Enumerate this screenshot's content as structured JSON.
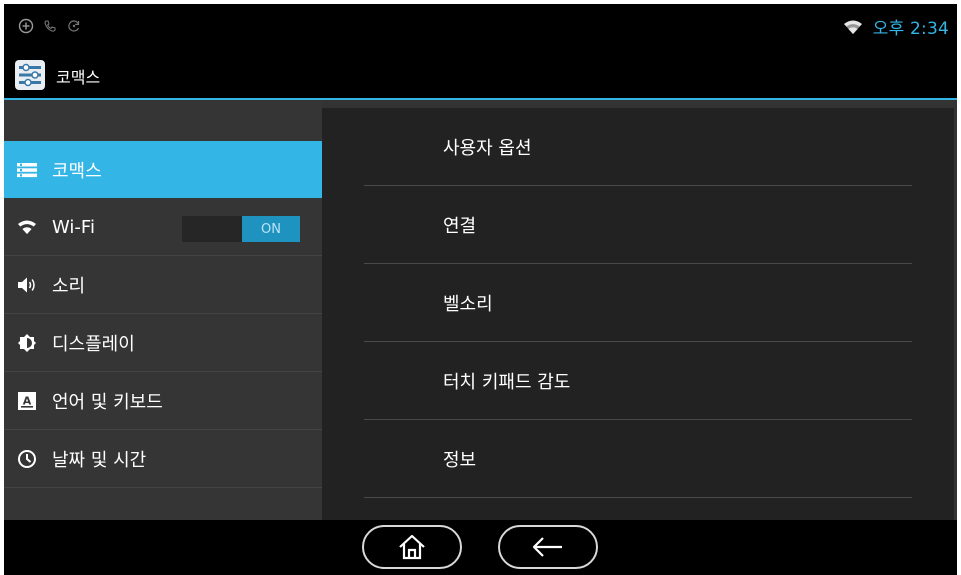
{
  "status_bar": {
    "left_icons": [
      "add-circle-icon",
      "phone-icon",
      "sync-icon"
    ],
    "wifi_icon": "wifi-icon",
    "time": "오후 2:34",
    "accent_color": "#33b5e5"
  },
  "action_bar": {
    "app_icon": "settings-sliders-icon",
    "title": "코맥스"
  },
  "sidebar": {
    "items": [
      {
        "label": "코맥스",
        "icon": "list-icon",
        "selected": true
      },
      {
        "label": "Wi-Fi",
        "icon": "wifi-icon",
        "toggle": "ON"
      },
      {
        "label": "소리",
        "icon": "speaker-icon"
      },
      {
        "label": "디스플레이",
        "icon": "brightness-icon"
      },
      {
        "label": "언어 및 키보드",
        "icon": "keyboard-a-icon"
      },
      {
        "label": "날짜 및 시간",
        "icon": "clock-icon"
      }
    ]
  },
  "panel": {
    "items": [
      "사용자 옵션",
      "연결",
      "벨소리",
      "터치 키패드 감도",
      "정보"
    ]
  },
  "nav_bar": {
    "home_icon": "home-icon",
    "back_icon": "back-arrow-icon"
  }
}
